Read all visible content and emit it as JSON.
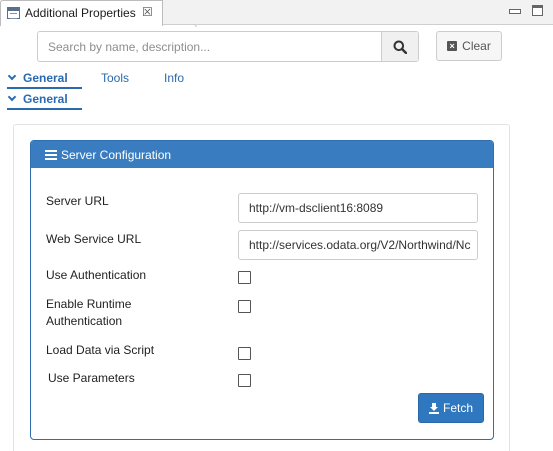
{
  "view_tab": {
    "title": "Additional Properties",
    "close_glyph": "☒"
  },
  "search": {
    "placeholder": "Search by name, description...",
    "value": "",
    "clear_label": "Clear"
  },
  "nav": {
    "tabs": [
      {
        "label": "General",
        "active": true
      },
      {
        "label": "Tools",
        "active": false
      },
      {
        "label": "Info",
        "active": false
      }
    ],
    "section_label": "General"
  },
  "server_config": {
    "header": "Server Configuration",
    "fields": {
      "server_url": {
        "label": "Server URL",
        "value": "http://vm-dsclient16:8089"
      },
      "web_service_url": {
        "label": "Web Service URL",
        "value": "http://services.odata.org/V2/Northwind/Nc"
      },
      "use_authentication": {
        "label": "Use Authentication",
        "checked": false
      },
      "enable_runtime_auth": {
        "label_line1": "Enable Runtime",
        "label_line2": "Authentication",
        "checked": false
      },
      "load_data_via_script": {
        "label": "Load Data via Script",
        "checked": false
      },
      "use_parameters": {
        "label": "Use Parameters",
        "checked": false
      }
    },
    "fetch_label": "Fetch"
  },
  "colors": {
    "accent": "#2a6ab0",
    "header_bg": "#3a7cc0",
    "button_bg": "#2f78c0"
  },
  "icons": [
    "properties-view-icon",
    "close-icon",
    "minimize-icon",
    "maximize-icon",
    "search-icon",
    "clear-icon",
    "chevron-down-icon",
    "list-icon",
    "download-icon"
  ]
}
